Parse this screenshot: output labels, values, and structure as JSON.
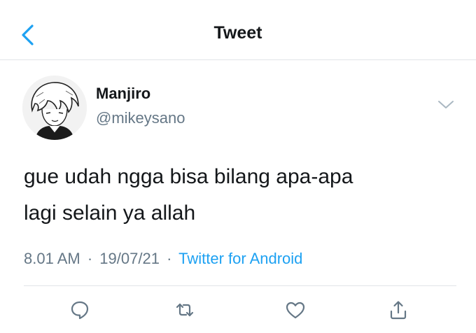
{
  "header": {
    "title": "Tweet",
    "back_icon": "chevron-left-icon"
  },
  "tweet": {
    "author_name": "Manjiro",
    "author_handle": "@mikeysano",
    "text_line1": "gue udah ngga bisa bilang apa-apa",
    "text_line2": "lagi selain ya allah",
    "time": "8.01 AM",
    "date": "19/07/21",
    "client": "Twitter for Android",
    "separator": "·"
  },
  "actions": [
    "reply-icon",
    "retweet-icon",
    "like-icon",
    "share-icon"
  ],
  "colors": {
    "accent": "#1da1f2",
    "muted": "#657786",
    "text": "#14171a",
    "divider": "#e1e4e8"
  }
}
